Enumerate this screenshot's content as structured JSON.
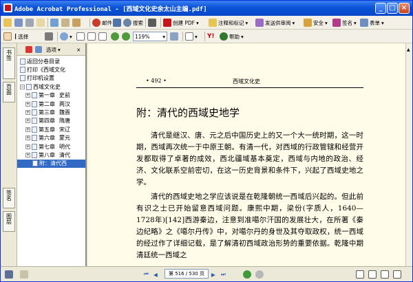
{
  "window": {
    "title": "Adobe Acrobat Professional - [西域文化史余太山主编.pdf]",
    "btn_min": "_",
    "btn_max": "□",
    "btn_close": "×"
  },
  "menubar": {
    "save_label": "",
    "print_label": "",
    "email_label": "邮件",
    "search_label": "搜索",
    "create_pdf": "创建 PDF",
    "comment_markup": "注释和标记",
    "send_review": "发送供审阅",
    "security": "安全",
    "sign": "签名",
    "forms": "表单"
  },
  "toolbar2": {
    "select_label": "选择",
    "zoom": "119%",
    "help": "帮助"
  },
  "sidebar_tabs": {
    "bookmarks": "书签",
    "pages": "页面",
    "signatures": "签名",
    "layers": "图层"
  },
  "bookmarks": {
    "options_label": "选项",
    "items": [
      {
        "label": "返回分卷目录",
        "level": 0
      },
      {
        "label": "打印《西域文化",
        "level": 0
      },
      {
        "label": "打印机设置",
        "level": 0
      },
      {
        "label": "西域文化史",
        "level": 0
      },
      {
        "label": "第一章",
        "sub": "史前",
        "level": 1
      },
      {
        "label": "第二章",
        "sub": "两汉",
        "level": 1
      },
      {
        "label": "第三章",
        "sub": "魏晋",
        "level": 1
      },
      {
        "label": "第四章",
        "sub": "隋唐",
        "level": 1
      },
      {
        "label": "第五章",
        "sub": "宋辽",
        "level": 1
      },
      {
        "label": "第六章",
        "sub": "蒙元",
        "level": 1
      },
      {
        "label": "第七章",
        "sub": "明代",
        "level": 1
      },
      {
        "label": "第八章",
        "sub": "清代",
        "level": 1
      },
      {
        "label": "附：清代西",
        "level": 2
      }
    ]
  },
  "page": {
    "page_no": "• 492 •",
    "running_head": "西域文化史",
    "heading": "附：清代的西域史地学",
    "paragraphs": [
      "清代是继汉、唐、元之后中国历史上的又一个大一统时期，这一时期，西域再次统一于中原王朝。有清一代，对西域的行政管辖和经营开发都取得了卓著的成效，西北疆域基本奠定，西域与内地的政治、经济、文化联系空前密切，在这一历史背景和条件下，兴起了西域史地之学。",
      "清代的西域史地之学应该说是在乾隆朝统一西域后兴起的。但此前有识之士已开始留意西域问题。康熙中期，梁份(字质人，1640—1728年)[142]西游秦边，注意到准噶尔汗国的发展壮大，在所著《秦边纪略》之《噶尔丹传》中，对噶尔丹的身世及其夺取政权，统一西域的经过作了详细记载，是了解清初西域政治形势的重要依据。乾隆中期清廷统一西域之"
    ]
  },
  "statusbar": {
    "page_display": "第 516 / 530 页"
  }
}
